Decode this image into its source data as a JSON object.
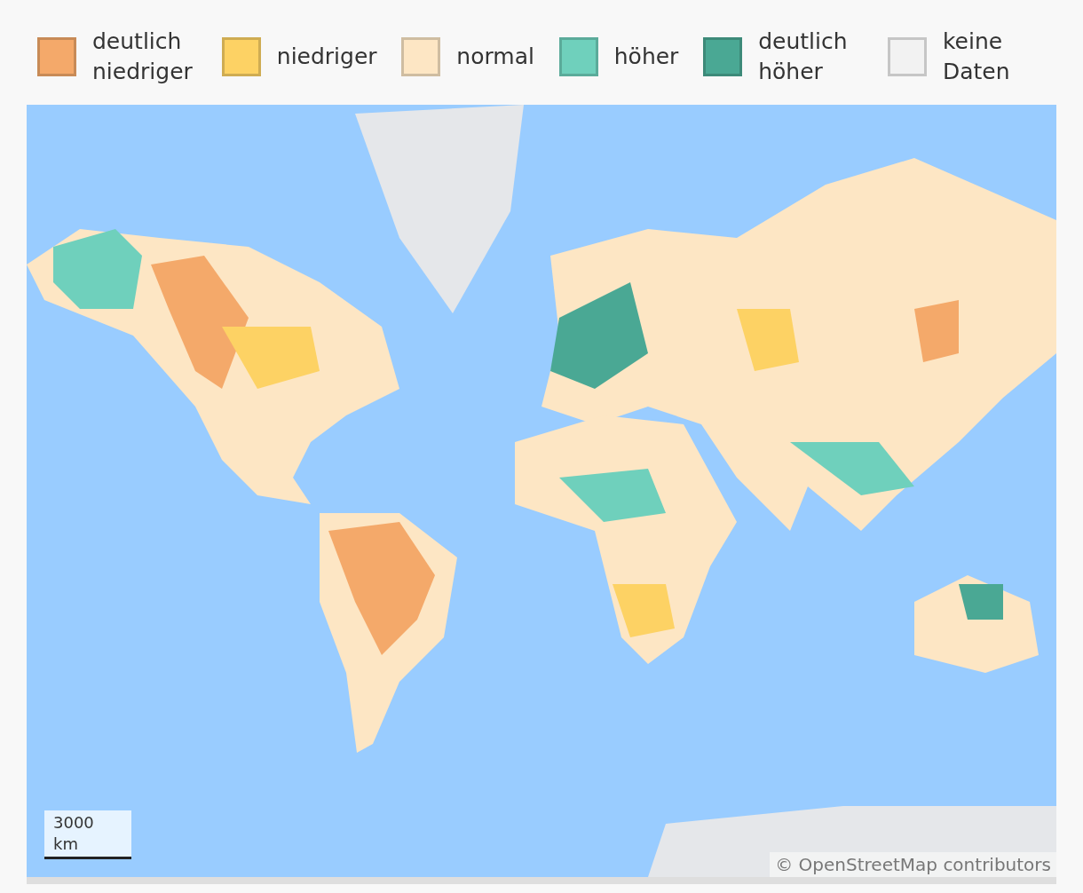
{
  "legend": [
    {
      "label": "deutlich niedriger",
      "color": "#f4a96a"
    },
    {
      "label": "niedriger",
      "color": "#fdd264"
    },
    {
      "label": "normal",
      "color": "#fde6c4"
    },
    {
      "label": "höher",
      "color": "#6fd0bc"
    },
    {
      "label": "deutlich höher",
      "color": "#4aa894"
    },
    {
      "label": "keine Daten",
      "color": "#f2f2f2"
    }
  ],
  "map": {
    "scale": "3000 km",
    "attribution": "© OpenStreetMap contributors"
  }
}
